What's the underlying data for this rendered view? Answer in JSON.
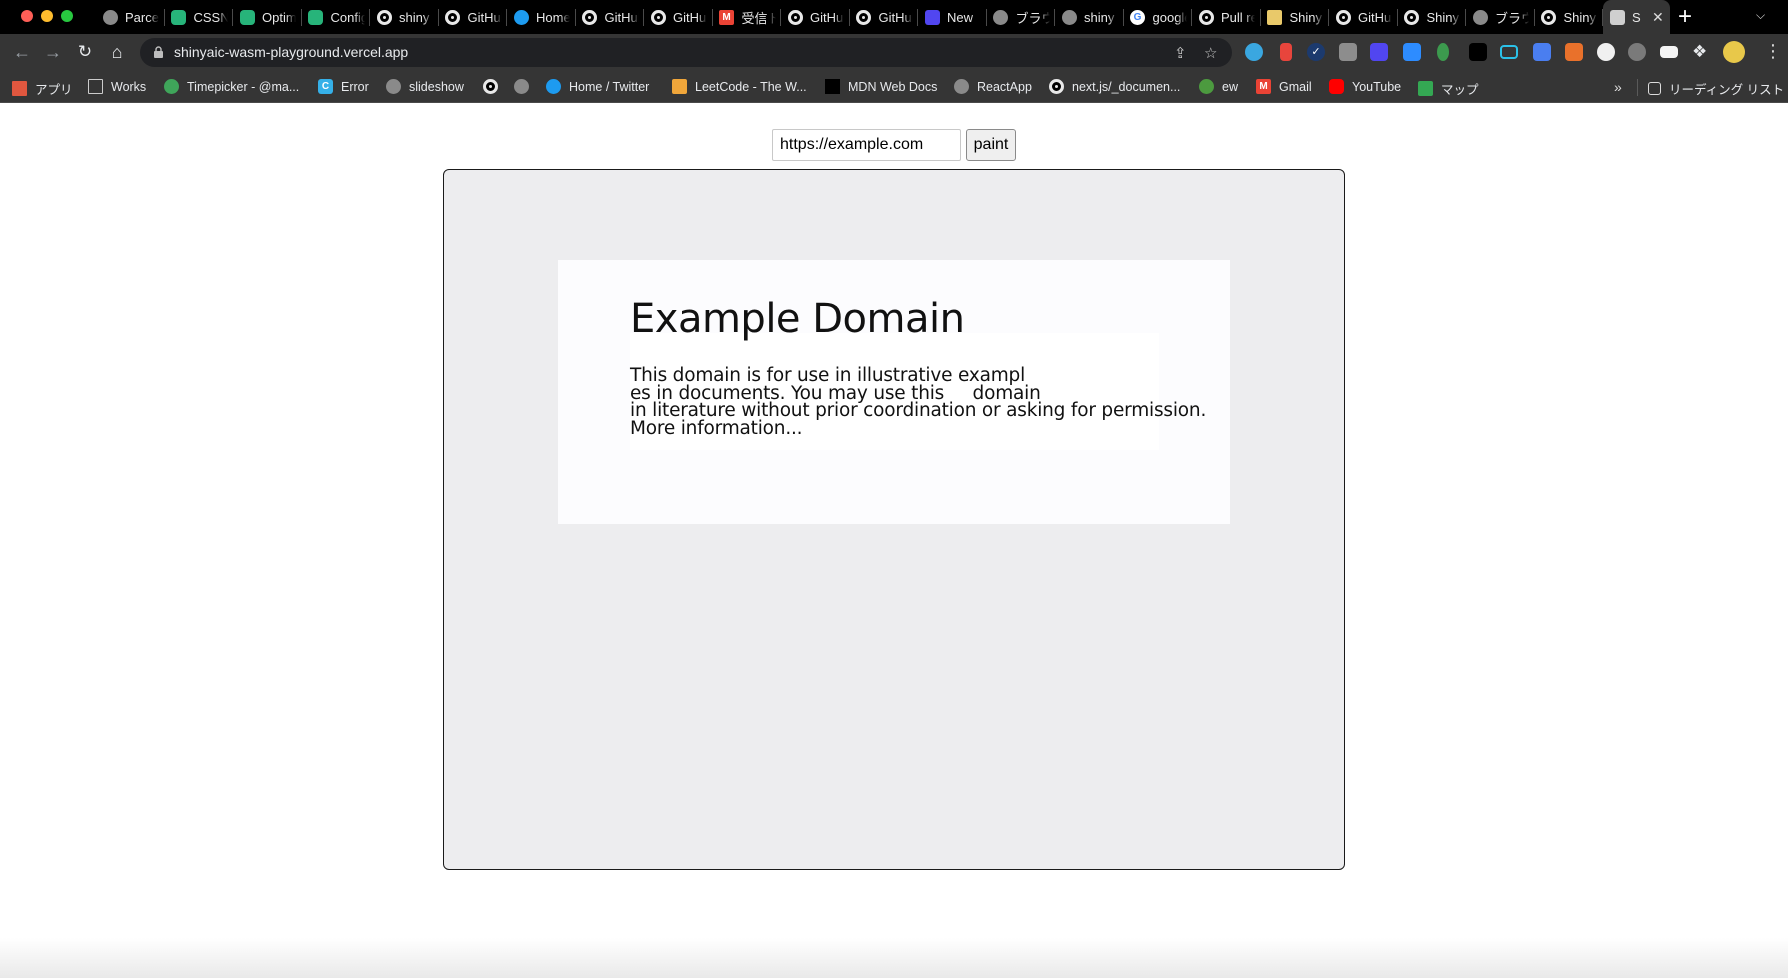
{
  "browser": {
    "tabs": [
      {
        "label": "Parcel",
        "icon": "globe-icon"
      },
      {
        "label": "CSSNano",
        "icon": "cssnano-icon"
      },
      {
        "label": "Optimizations",
        "icon": "cssnano-icon"
      },
      {
        "label": "Config",
        "icon": "cssnano-icon"
      },
      {
        "label": "shiny",
        "icon": "github-icon"
      },
      {
        "label": "GitHub",
        "icon": "github-icon"
      },
      {
        "label": "Home",
        "icon": "twitter-icon"
      },
      {
        "label": "GitHub",
        "icon": "github-icon"
      },
      {
        "label": "GitHub",
        "icon": "github-icon"
      },
      {
        "label": "受信トレイ",
        "icon": "gmail-icon"
      },
      {
        "label": "GitHub",
        "icon": "github-icon"
      },
      {
        "label": "GitHub",
        "icon": "github-icon"
      },
      {
        "label": "New",
        "icon": "linear-icon"
      },
      {
        "label": "ブラウザ",
        "icon": "globe-icon"
      },
      {
        "label": "shiny",
        "icon": "globe-icon"
      },
      {
        "label": "google",
        "icon": "google-icon"
      },
      {
        "label": "Pull requests",
        "icon": "github-icon"
      },
      {
        "label": "Shiny",
        "icon": "avatar-icon"
      },
      {
        "label": "GitHub",
        "icon": "github-icon"
      },
      {
        "label": "Shiny",
        "icon": "github-icon"
      },
      {
        "label": "ブラウザ",
        "icon": "globe-icon"
      },
      {
        "label": "Shiny",
        "icon": "github-icon"
      },
      {
        "label": "S",
        "icon": "svelte-icon",
        "active": true
      }
    ],
    "new_tab_label": "+",
    "tab_search_label": "⌄",
    "close_label": "✕",
    "omnibox_url": "shinyaic-wasm-playground.vercel.app",
    "bookmarks": [
      {
        "label": "アプリ",
        "icon": "apps-grid-icon"
      },
      {
        "label": "Works",
        "icon": "folder-icon"
      },
      {
        "label": "Timepicker - @ma...",
        "icon": "timepicker-icon"
      },
      {
        "label": "Error",
        "icon": "c-icon"
      },
      {
        "label": "slideshow",
        "icon": "globe-icon"
      },
      {
        "label": "",
        "icon": "github-icon"
      },
      {
        "label": "",
        "icon": "globe-icon"
      },
      {
        "label": "Home / Twitter",
        "icon": "twitter-icon"
      },
      {
        "label": "LeetCode - The W...",
        "icon": "leetcode-icon"
      },
      {
        "label": "MDN Web Docs",
        "icon": "mdn-icon"
      },
      {
        "label": "ReactApp",
        "icon": "globe-icon"
      },
      {
        "label": "next.js/_documen...",
        "icon": "github-icon"
      },
      {
        "label": "ew",
        "icon": "node-icon"
      },
      {
        "label": "Gmail",
        "icon": "gmail-icon"
      },
      {
        "label": "YouTube",
        "icon": "youtube-icon"
      },
      {
        "label": "マップ",
        "icon": "maps-icon"
      }
    ],
    "more_bookmarks_label": "»",
    "reading_list_label": "リーディング リスト"
  },
  "page": {
    "url_input_value": "https://example.com",
    "paint_button_label": "paint",
    "rendered": {
      "title": "Example Domain",
      "paragraph_lines": [
        "This domain is for use in illustrative exampl",
        "es in documents. You may use this     domain",
        "in literature without prior coordination or asking for permission.",
        "More information..."
      ]
    }
  },
  "colors": {
    "canvas_bg": "#ededef",
    "render_bg": "#fcfcfe",
    "tabstrip_bg": "#000000",
    "toolbar_bg": "#353535"
  }
}
